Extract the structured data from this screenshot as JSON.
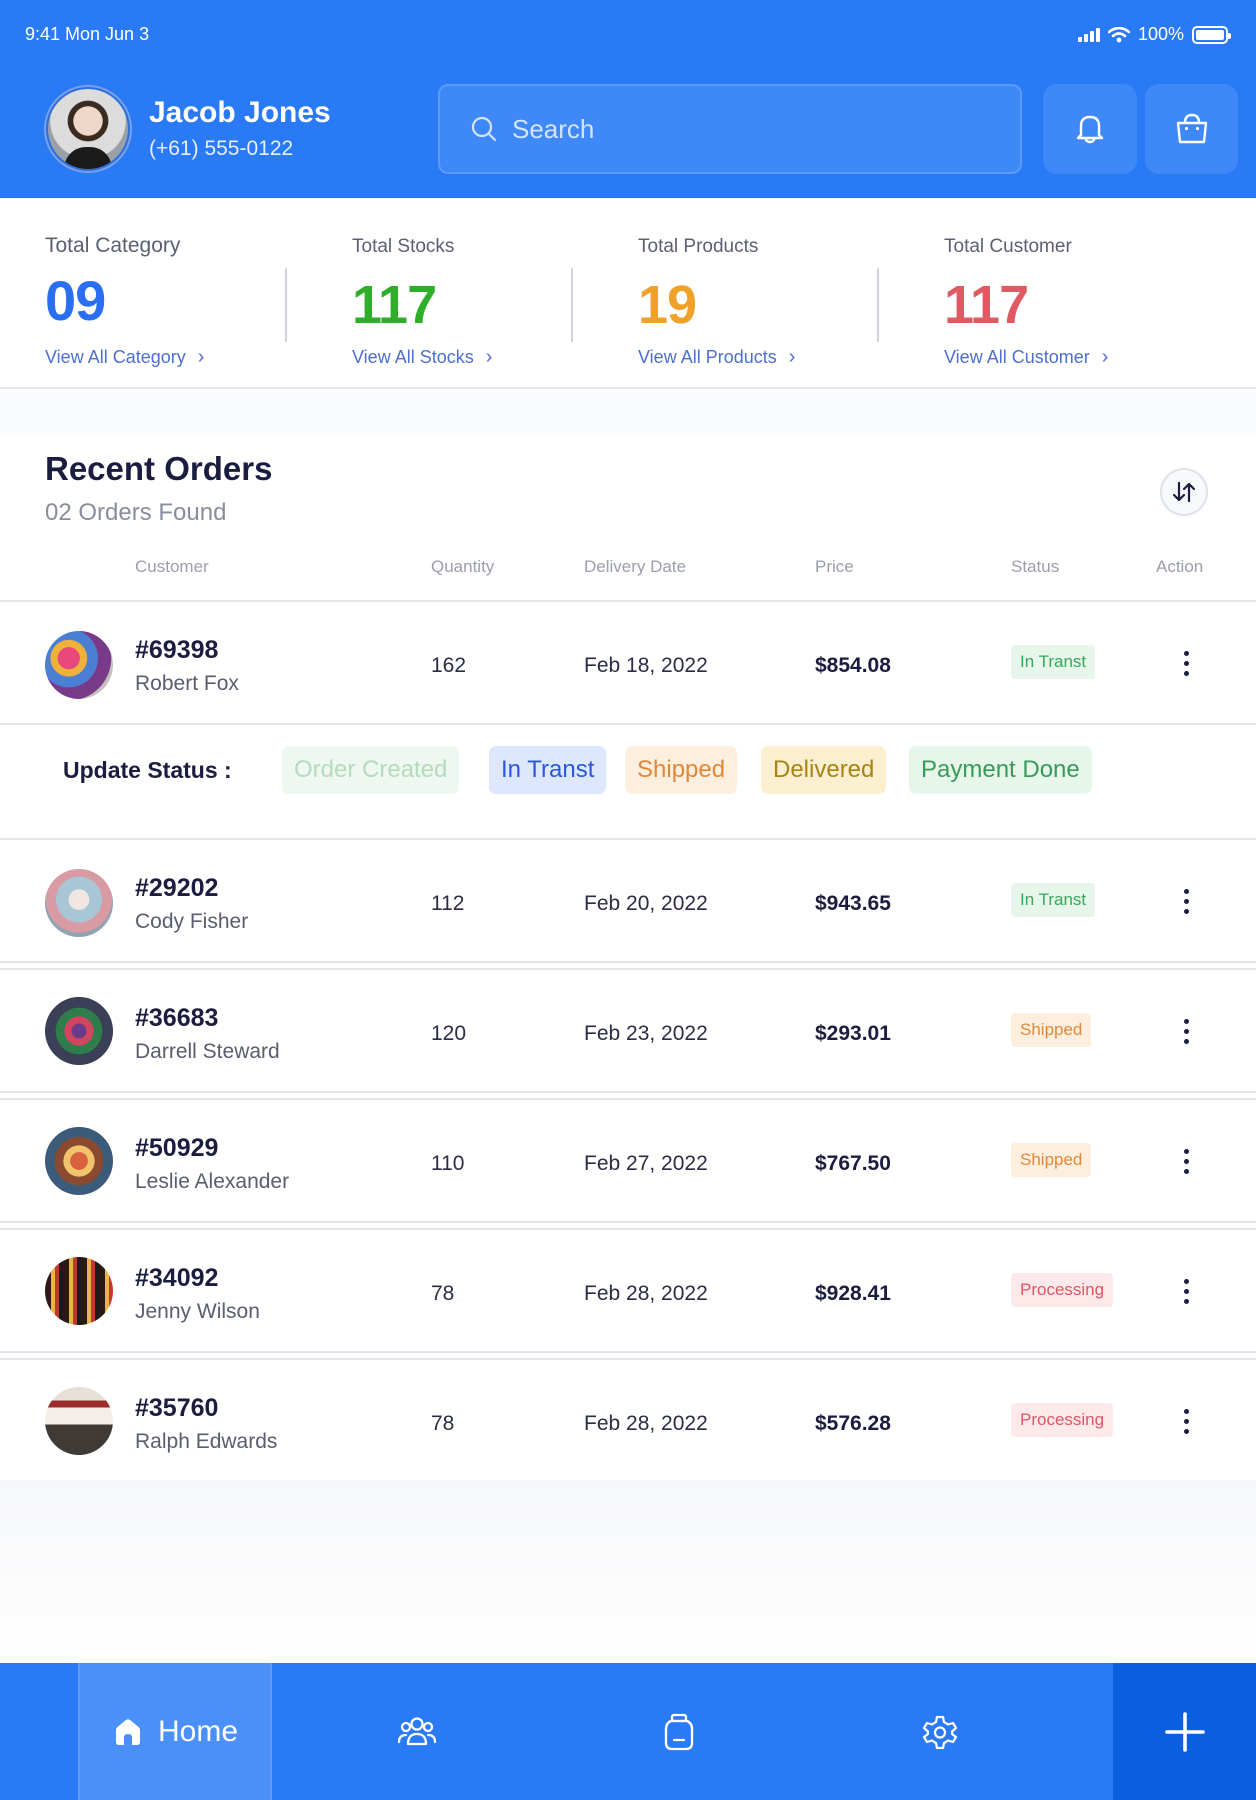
{
  "status_bar": {
    "time": "9:41 Mon Jun 3",
    "battery": "100%"
  },
  "user": {
    "name": "Jacob Jones",
    "phone": "(+61) 555-0122"
  },
  "search": {
    "placeholder": "Search"
  },
  "stats": [
    {
      "label": "Total Category",
      "value": "09",
      "link": "View All Category",
      "color": "#2a6ff2"
    },
    {
      "label": "Total Stocks",
      "value": "117",
      "link": "View All Stocks",
      "color": "#2fae2a"
    },
    {
      "label": "Total Products",
      "value": "19",
      "link": "View All Products",
      "color": "#f0a12a"
    },
    {
      "label": "Total Customer",
      "value": "117",
      "link": "View All Customer",
      "color": "#e05a64"
    }
  ],
  "orders": {
    "title": "Recent Orders",
    "count": "02 Orders Found",
    "columns": {
      "customer": "Customer",
      "quantity": "Quantity",
      "delivery_date": "Delivery Date",
      "price": "Price",
      "status": "Status",
      "action": "Action"
    },
    "rows": [
      {
        "id": "#69398",
        "name": "Robert Fox",
        "quantity": "162",
        "date": "Feb 18, 2022",
        "price": "$854.08",
        "status": "In Transt",
        "status_type": "transit"
      },
      {
        "id": "#29202",
        "name": "Cody Fisher",
        "quantity": "112",
        "date": "Feb 20, 2022",
        "price": "$943.65",
        "status": "In Transt",
        "status_type": "transit"
      },
      {
        "id": "#36683",
        "name": "Darrell Steward",
        "quantity": "120",
        "date": "Feb 23, 2022",
        "price": "$293.01",
        "status": "Shipped",
        "status_type": "shipped"
      },
      {
        "id": "#50929",
        "name": "Leslie Alexander",
        "quantity": "110",
        "date": "Feb 27, 2022",
        "price": "$767.50",
        "status": "Shipped",
        "status_type": "shipped"
      },
      {
        "id": "#34092",
        "name": "Jenny Wilson",
        "quantity": "78",
        "date": "Feb 28, 2022",
        "price": "$928.41",
        "status": "Processing",
        "status_type": "processing"
      },
      {
        "id": "#35760",
        "name": "Ralph Edwards",
        "quantity": "78",
        "date": "Feb 28, 2022",
        "price": "$576.28",
        "status": "Processing",
        "status_type": "processing"
      }
    ]
  },
  "update_status": {
    "label": "Update Status :",
    "options": [
      "Order Created",
      "In Transt",
      "Shipped",
      "Delivered",
      "Payment Done"
    ],
    "selected": "In Transt"
  },
  "nav": {
    "home_label": "Home",
    "items": [
      "home-icon",
      "users-icon",
      "jar-icon",
      "settings-icon",
      "plus-icon"
    ]
  },
  "colors": {
    "brand": "#2a7af6",
    "brand_dark": "#0b60e0"
  }
}
